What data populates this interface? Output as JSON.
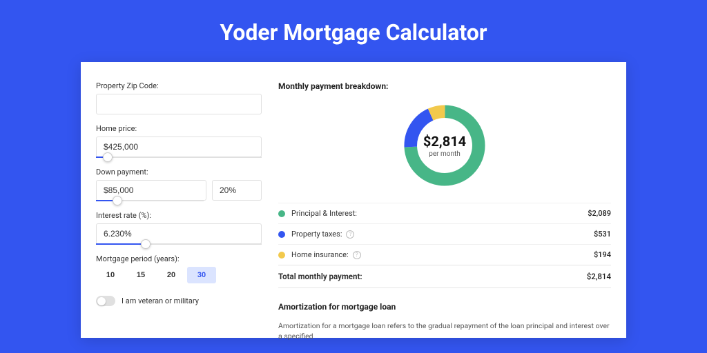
{
  "title": "Yoder Mortgage Calculator",
  "form": {
    "zip_label": "Property Zip Code:",
    "zip_value": "",
    "home_price_label": "Home price:",
    "home_price_value": "$425,000",
    "home_price_slider_pct": 7,
    "down_payment_label": "Down payment:",
    "down_payment_value": "$85,000",
    "down_payment_pct_value": "20%",
    "down_payment_slider_pct": 20,
    "interest_label": "Interest rate (%):",
    "interest_value": "6.230%",
    "interest_slider_pct": 30,
    "period_label": "Mortgage period (years):",
    "periods": [
      "10",
      "15",
      "20",
      "30"
    ],
    "period_selected_index": 3,
    "veteran_label": "I am veteran or military",
    "veteran_on": false
  },
  "breakdown": {
    "heading": "Monthly payment breakdown:",
    "center_amount": "$2,814",
    "center_sub": "per month",
    "rows": [
      {
        "color": "#47b687",
        "label": "Principal & Interest:",
        "info": false,
        "value": "$2,089"
      },
      {
        "color": "#3355f0",
        "label": "Property taxes:",
        "info": true,
        "value": "$531"
      },
      {
        "color": "#f2c94c",
        "label": "Home insurance:",
        "info": true,
        "value": "$194"
      }
    ],
    "total_label": "Total monthly payment:",
    "total_value": "$2,814"
  },
  "amort": {
    "heading": "Amortization for mortgage loan",
    "text": "Amortization for a mortgage loan refers to the gradual repayment of the loan principal and interest over a specified"
  },
  "chart_data": {
    "type": "pie",
    "title": "Monthly payment breakdown",
    "series": [
      {
        "name": "Principal & Interest",
        "value": 2089,
        "color": "#47b687"
      },
      {
        "name": "Property taxes",
        "value": 531,
        "color": "#3355f0"
      },
      {
        "name": "Home insurance",
        "value": 194,
        "color": "#f2c94c"
      }
    ],
    "total": 2814,
    "center_label": "$2,814 per month"
  }
}
